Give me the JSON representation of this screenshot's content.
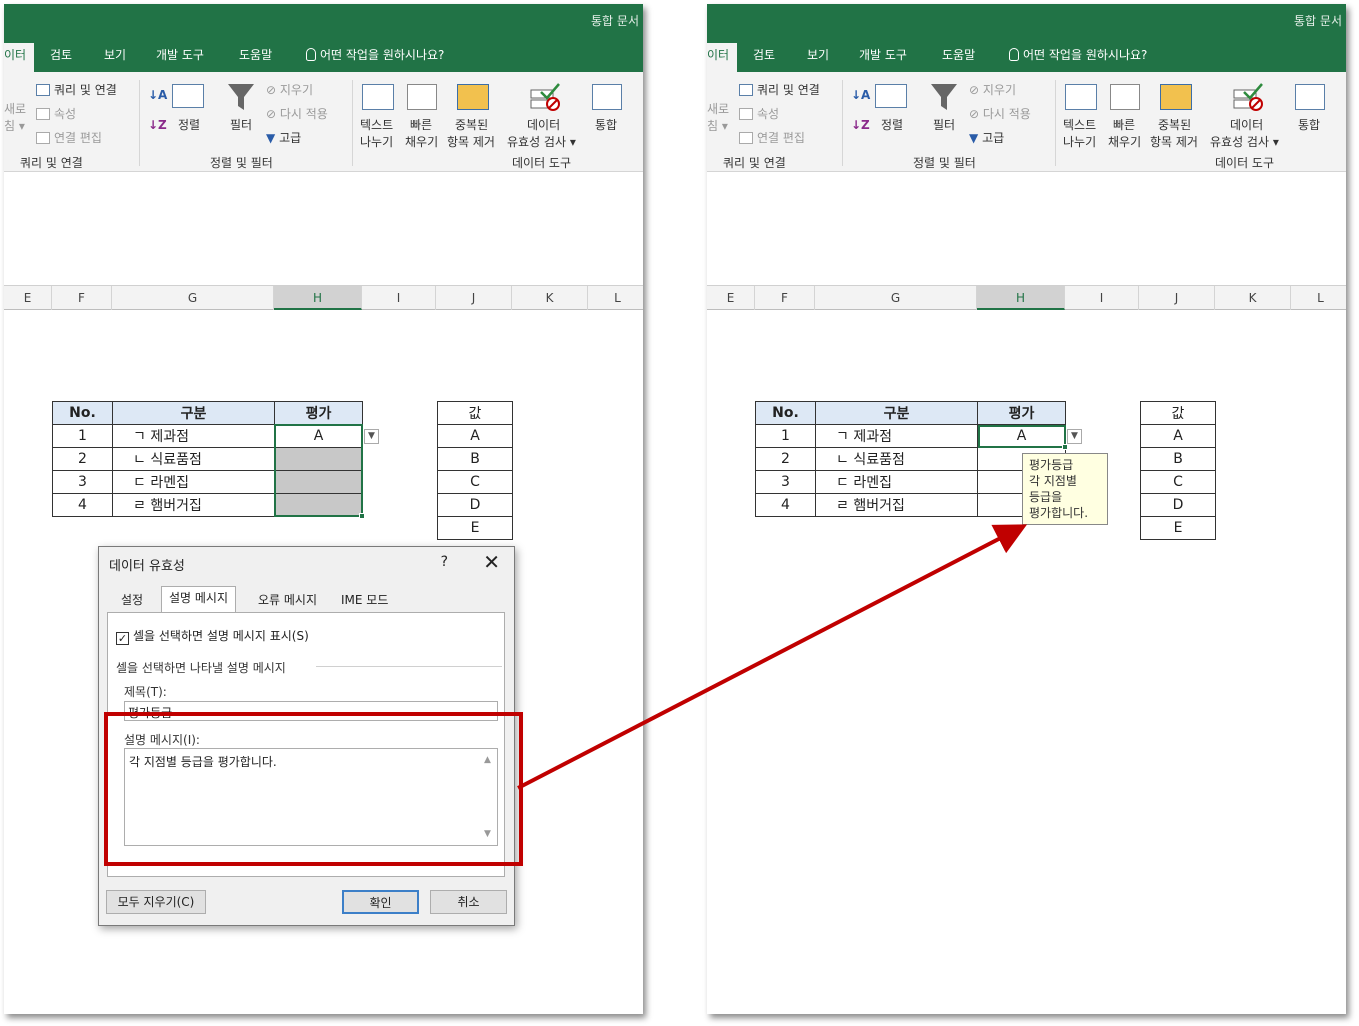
{
  "window": {
    "title": "통합 문서"
  },
  "ribbon": {
    "tabs": [
      "이터",
      "검토",
      "보기",
      "개발 도구",
      "도움말"
    ],
    "tell_me": "어떤 작업을 원하시나요?",
    "refresh_partial": [
      "새로",
      "침 ▾"
    ],
    "queries_connections": "쿼리 및 연결",
    "properties": "속성",
    "edit_links": "연결 편집",
    "group_queries": "쿼리 및 연결",
    "sort": "정렬",
    "filter": "필터",
    "clear": "지우기",
    "reapply": "다시 적용",
    "advanced": "고급",
    "group_sort_filter": "정렬 및 필터",
    "text_to_columns": [
      "텍스트",
      "나누기"
    ],
    "flash_fill": [
      "빠른",
      "채우기"
    ],
    "remove_duplicates": [
      "중복된",
      "항목 제거"
    ],
    "data_validation": [
      "데이터",
      "유효성 검사 ▾"
    ],
    "consolidate": "통합",
    "group_data_tools": "데이터 도구"
  },
  "columns": [
    "E",
    "F",
    "G",
    "H",
    "I",
    "J",
    "K",
    "L"
  ],
  "sheet": {
    "headers": [
      "No.",
      "구분",
      "평가"
    ],
    "rows": [
      {
        "no": "1",
        "name": "ㄱ 제과점",
        "grade": "A"
      },
      {
        "no": "2",
        "name": "ㄴ 식료품점",
        "grade": ""
      },
      {
        "no": "3",
        "name": "ㄷ 라멘집",
        "grade": ""
      },
      {
        "no": "4",
        "name": "ㄹ 햄버거집",
        "grade": ""
      }
    ],
    "value_list_header": "값",
    "value_list": [
      "A",
      "B",
      "C",
      "D",
      "E"
    ]
  },
  "dialog": {
    "title": "데이터 유효성",
    "help": "?",
    "close": "✕",
    "tabs": [
      "설정",
      "설명 메시지",
      "오류 메시지",
      "IME 모드"
    ],
    "show_input_message": "셀을 선택하면 설명 메시지 표시(S)",
    "section_title": "셀을 선택하면 나타낼 설명 메시지",
    "title_label": "제목(T):",
    "title_value": "평가등급",
    "message_label": "설명 메시지(I):",
    "message_value": "각 지점별 등급을 평가합니다.",
    "clear_all": "모두 지우기(C)",
    "ok": "확인",
    "cancel": "취소"
  },
  "tooltip": {
    "title": "평가등급",
    "lines": [
      "각 지점별",
      "등급을",
      "평가합니다."
    ]
  },
  "colors": {
    "excel_green": "#217346",
    "highlight_red": "#c00000",
    "header_fill": "#dde8f5",
    "selected_fill": "#c8c8c8",
    "tooltip_fill": "#ffffe1"
  }
}
